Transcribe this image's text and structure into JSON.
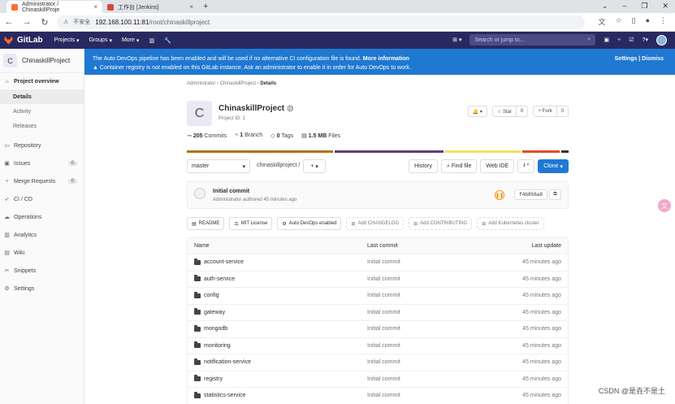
{
  "browser": {
    "tabs": [
      {
        "title": "Administrator / ChinaskillProje",
        "active": true,
        "color": "#fc6d26"
      },
      {
        "title": "工作台 [Jenkins]",
        "active": false,
        "color": "#d24939"
      }
    ],
    "new_tab": "+",
    "not_secure": "不安全",
    "url_host": "192.168.100.11:81",
    "url_path": "/root/chinaskillproject"
  },
  "gitlab_header": {
    "brand": "GitLab",
    "nav": [
      "Projects",
      "Groups",
      "More"
    ],
    "search_placeholder": "Search or jump to..."
  },
  "sidebar": {
    "project_initial": "C",
    "project_name": "ChinaskillProject",
    "overview": "Project overview",
    "overview_sub": [
      "Details",
      "Activity",
      "Releases"
    ],
    "items": [
      {
        "label": "Repository",
        "icon": "repo-icon",
        "count": null
      },
      {
        "label": "Issues",
        "icon": "issues-icon",
        "count": "0"
      },
      {
        "label": "Merge Requests",
        "icon": "merge-icon",
        "count": "0"
      },
      {
        "label": "CI / CD",
        "icon": "rocket-icon",
        "count": null
      },
      {
        "label": "Operations",
        "icon": "cloud-icon",
        "count": null
      },
      {
        "label": "Analytics",
        "icon": "chart-icon",
        "count": null
      },
      {
        "label": "Wiki",
        "icon": "book-icon",
        "count": null
      },
      {
        "label": "Snippets",
        "icon": "scissors-icon",
        "count": null
      },
      {
        "label": "Settings",
        "icon": "gear-icon",
        "count": null
      }
    ]
  },
  "banner": {
    "line1": "The Auto DevOps pipeline has been enabled and will be used if no alternative CI configuration file is found.",
    "line1_link": "More information",
    "line2": "Container registry is not enabled on this GitLab instance. Ask an administrator to enable it in order for Auto DevOps to work.",
    "settings": "Settings",
    "separator": "|",
    "dismiss": "Dismiss"
  },
  "breadcrumb": {
    "a": "Administrator",
    "b": "ChinaskillProject",
    "c": "Details"
  },
  "project": {
    "initial": "C",
    "title": "ChinaskillProject",
    "id_text": "Project ID: 1",
    "star_label": "Star",
    "star_count": "0",
    "fork_label": "Fork",
    "fork_count": "0"
  },
  "stats": {
    "commits_n": "205",
    "commits_l": "Commits",
    "branch_n": "1",
    "branch_l": "Branch",
    "tags_n": "0",
    "tags_l": "Tags",
    "files_n": "1.5 MB",
    "files_l": "Files"
  },
  "lang_colors": [
    "#b07219",
    "#563d7c",
    "#f1e05a",
    "#e34c26",
    "#333333"
  ],
  "lang_widths": [
    0.39,
    0.29,
    0.2,
    0.1,
    0.02
  ],
  "toolbar": {
    "branch": "master",
    "path": "chinaskillproject",
    "path_sep": "/",
    "plus": "+",
    "history": "History",
    "find": "Find file",
    "webide": "Web IDE",
    "clone": "Clone"
  },
  "commit": {
    "title": "Initial commit",
    "sub": "Administrator authored 45 minutes ago",
    "sha": "f4b856a8"
  },
  "shortcuts": [
    {
      "label": "README",
      "dashed": false,
      "icon": "file-icon"
    },
    {
      "label": "MIT License",
      "dashed": false,
      "icon": "scale-icon"
    },
    {
      "label": "Auto DevOps enabled",
      "dashed": false,
      "icon": "gear-icon"
    },
    {
      "label": "Add CHANGELOG",
      "dashed": true,
      "icon": "plus-icon"
    },
    {
      "label": "Add CONTRIBUTING",
      "dashed": true,
      "icon": "plus-icon"
    },
    {
      "label": "Add Kubernetes cluster",
      "dashed": true,
      "icon": "plus-icon"
    }
  ],
  "table": {
    "headers": {
      "name": "Name",
      "last_commit": "Last commit",
      "last_update": "Last update"
    },
    "rows": [
      {
        "name": "account-service",
        "commit": "Initial commit",
        "update": "45 minutes ago"
      },
      {
        "name": "auth-service",
        "commit": "Initial commit",
        "update": "45 minutes ago"
      },
      {
        "name": "config",
        "commit": "Initial commit",
        "update": "45 minutes ago"
      },
      {
        "name": "gateway",
        "commit": "Initial commit",
        "update": "45 minutes ago"
      },
      {
        "name": "mongodb",
        "commit": "Initial commit",
        "update": "45 minutes ago"
      },
      {
        "name": "monitoring",
        "commit": "Initial commit",
        "update": "45 minutes ago"
      },
      {
        "name": "notification-service",
        "commit": "Initial commit",
        "update": "45 minutes ago"
      },
      {
        "name": "registry",
        "commit": "Initial commit",
        "update": "45 minutes ago"
      },
      {
        "name": "statistics-service",
        "commit": "Initial commit",
        "update": "45 minutes ago"
      }
    ]
  },
  "watermark": "CSDN @是垚不是土"
}
